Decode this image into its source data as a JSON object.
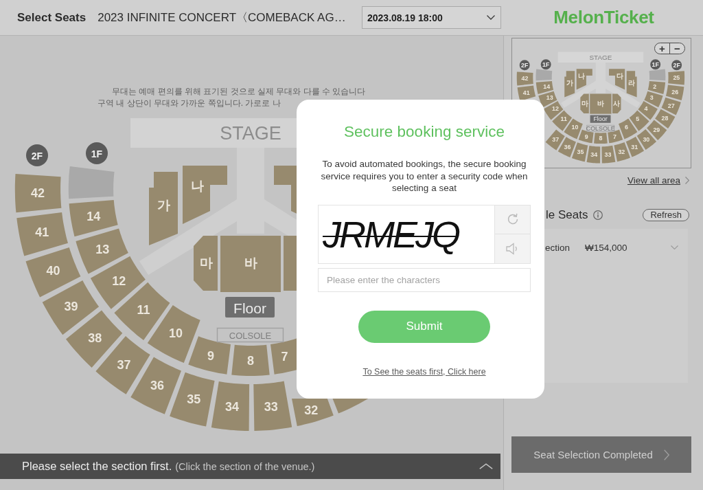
{
  "header": {
    "title": "Select Seats",
    "concert": "2023 INFINITE CONCERT〈COMEBACK AG…",
    "date_select": {
      "value": "2023.08.19 18:00"
    },
    "logo": "MelonTicket"
  },
  "seat_map": {
    "notes": [
      "무대는 예매 편의를 위해 표기된 것으로 실제 무대와 다를 수 있습니다",
      "구역 내 상단이 무대와 가까운 쪽입니다. 가로로 나"
    ],
    "stage": "STAGE",
    "level_badges": [
      "2F",
      "1F"
    ],
    "outer_ring": [
      {
        "label": "42",
        "available": true
      },
      {
        "label": "41",
        "available": true
      },
      {
        "label": "40",
        "available": true
      },
      {
        "label": "39",
        "available": true
      },
      {
        "label": "38",
        "available": true
      },
      {
        "label": "37",
        "available": true
      },
      {
        "label": "36",
        "available": true
      },
      {
        "label": "35",
        "available": true
      },
      {
        "label": "34",
        "available": true
      },
      {
        "label": "33",
        "available": true
      },
      {
        "label": "32",
        "available": true
      },
      {
        "available": true
      }
    ],
    "inner_ring": [
      {
        "available": false
      },
      {
        "label": "14",
        "available": true
      },
      {
        "label": "13",
        "available": true
      },
      {
        "label": "12",
        "available": true
      },
      {
        "label": "11",
        "available": true
      },
      {
        "label": "10",
        "available": true
      },
      {
        "label": "9",
        "available": true
      },
      {
        "label": "8",
        "available": true
      },
      {
        "label": "7",
        "available": true
      }
    ],
    "floor_blocks_upper": [
      {
        "label": "가",
        "available": true
      },
      {
        "label": "나",
        "available": true
      },
      {
        "available": true
      }
    ],
    "floor_blocks_lower": [
      {
        "label": "마",
        "available": true
      },
      {
        "label": "바",
        "available": true
      },
      {
        "available": true
      }
    ],
    "floor_label": "Floor",
    "console_label": "COLSOLE"
  },
  "status_bar": {
    "message": "Please select the section first.",
    "hint": "(Click the section of the venue.)"
  },
  "side_panel": {
    "minimap": {
      "stage": "STAGE",
      "level_badges": [
        "2F",
        "1F",
        "1F",
        "2F"
      ],
      "outer_ring_top": [
        {
          "label": "42",
          "available": true
        },
        {
          "label": "41",
          "available": true
        }
      ],
      "outer_ring_bottom": [
        {
          "label": "37",
          "available": true
        },
        {
          "label": "36",
          "available": true
        },
        {
          "label": "35",
          "available": true
        },
        {
          "label": "34",
          "available": true
        },
        {
          "label": "33",
          "available": true
        },
        {
          "label": "32",
          "available": true
        },
        {
          "label": "31",
          "available": true
        },
        {
          "label": "30",
          "available": true
        },
        {
          "label": "29",
          "available": true
        },
        {
          "label": "28",
          "available": true
        },
        {
          "label": "27",
          "available": true
        },
        {
          "label": "26",
          "available": true
        },
        {
          "label": "25",
          "available": true
        }
      ],
      "inner_ring": [
        {
          "available": false
        },
        {
          "label": "14",
          "available": true
        },
        {
          "label": "13",
          "available": true
        },
        {
          "label": "12",
          "available": true
        },
        {
          "label": "11",
          "available": true
        },
        {
          "label": "10",
          "available": true
        },
        {
          "label": "9",
          "available": true
        },
        {
          "label": "8",
          "available": true
        },
        {
          "label": "7",
          "available": true
        },
        {
          "label": "6",
          "available": true
        },
        {
          "label": "5",
          "available": true
        },
        {
          "label": "4",
          "available": true
        },
        {
          "label": "3",
          "available": true
        },
        {
          "label": "2",
          "available": true
        },
        {
          "available": false
        }
      ],
      "floor_blocks_upper": [
        {
          "label": "가",
          "available": true
        },
        {
          "label": "나",
          "available": true
        },
        {
          "label": "다",
          "available": true
        },
        {
          "label": "라",
          "available": true
        }
      ],
      "floor_blocks_lower": [
        {
          "label": "마",
          "available": true
        },
        {
          "label": "바",
          "available": true
        },
        {
          "label": "사",
          "available": true
        }
      ],
      "floor_label": "Floor",
      "console_label": "COLSOLE",
      "zoom_in": "+",
      "zoom_out": "−"
    },
    "view_all": "View all area",
    "available_seats": {
      "title": "le Seats",
      "refresh": "Refresh",
      "rows": [
        {
          "section": "ection",
          "price": "₩154,000"
        }
      ]
    },
    "complete_button": "Seat Selection Completed"
  },
  "dialog": {
    "title": "Secure booking service",
    "message": "To avoid automated bookings, the secure booking service requires you to enter a security code when selecting a seat",
    "captcha": "JRMEJQ",
    "input": {
      "placeholder": "Please enter the characters"
    },
    "submit": "Submit",
    "link": "To See the seats first, Click here"
  }
}
